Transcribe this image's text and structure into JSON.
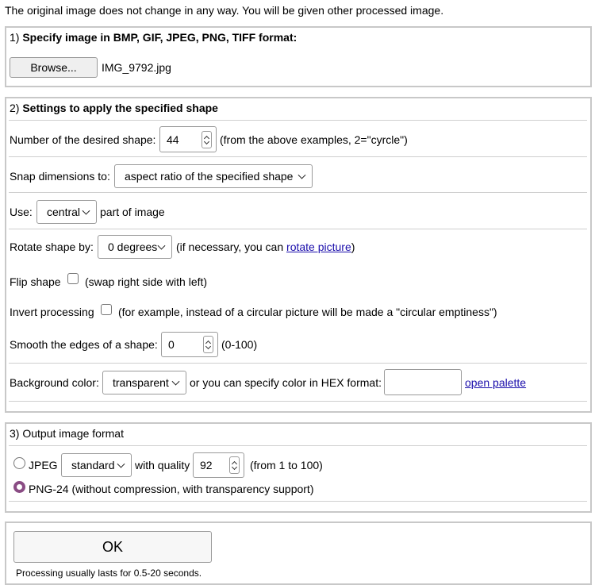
{
  "intro": "The original image does not change in any way. You will be given other processed image.",
  "section1": {
    "number": "1)",
    "title": "Specify image in BMP, GIF, JPEG, PNG, TIFF format:",
    "browse_label": "Browse...",
    "file_name": "IMG_9792.jpg"
  },
  "section2": {
    "number": "2)",
    "title": "Settings to apply the specified shape",
    "shape_label": "Number of the desired shape:",
    "shape_value": "44",
    "shape_hint": "(from the above examples, 2=\"cyrcle\")",
    "snap_label": "Snap dimensions to:",
    "snap_value": "aspect ratio of the specified shape",
    "use_label": "Use:",
    "use_value": "central",
    "use_suffix": "part of image",
    "rotate_label": "Rotate shape by:",
    "rotate_value": "0 degrees",
    "rotate_hint_prefix": "(if necessary, you can",
    "rotate_link": "rotate picture",
    "rotate_hint_suffix": ")",
    "flip_label": "Flip shape",
    "flip_hint": "(swap right side with left)",
    "invert_label": "Invert processing",
    "invert_hint": "(for example, instead of a circular picture will be made a \"circular emptiness\")",
    "smooth_label": "Smooth the edges of a shape:",
    "smooth_value": "0",
    "smooth_hint": "(0-100)",
    "bg_label": "Background color:",
    "bg_value": "transparent",
    "bg_hex_label": "or you can specify color in HEX format:",
    "bg_hex_value": "",
    "palette_link": "open palette"
  },
  "section3": {
    "number": "3)",
    "title": "Output image format",
    "jpeg_label": "JPEG",
    "jpeg_mode": "standard",
    "quality_label": "with quality",
    "quality_value": "92",
    "quality_hint": "(from 1 to 100)",
    "png_label": "PNG-24 (without compression, with transparency support)",
    "selected": "png"
  },
  "submit": {
    "ok_label": "OK",
    "note": "Processing usually lasts for 0.5-20 seconds."
  },
  "colors": {
    "border": "#c8c8c8",
    "link": "#1a0dab",
    "radio_accent": "#8a4c84"
  }
}
